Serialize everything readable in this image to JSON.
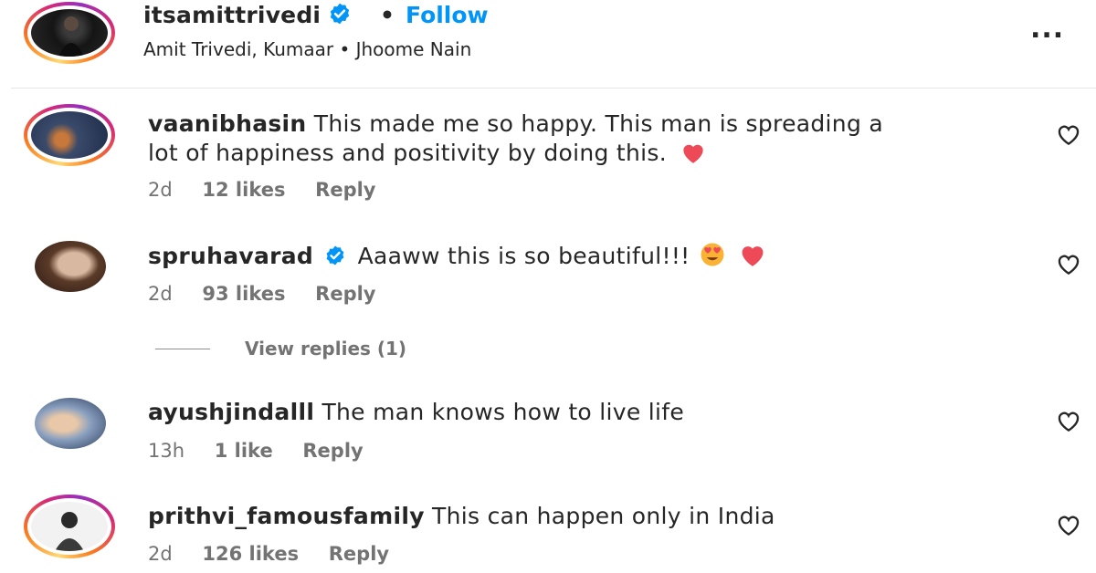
{
  "post": {
    "username": "itsamittrivedi",
    "separator": "•",
    "follow_label": "Follow",
    "audio": "Amit Trivedi, Kumaar • Jhoome Nain",
    "more_label": "..."
  },
  "comments": [
    {
      "username": "vaanibhasin",
      "text_line1": "This made me so happy. This man is spreading a",
      "text_line2": "lot of happiness and positivity by doing this.",
      "time": "2d",
      "likes": "12 likes",
      "reply": "Reply"
    },
    {
      "username": "spruhavarad",
      "text": "Aaaww this is so beautiful!!!",
      "time": "2d",
      "likes": "93 likes",
      "reply": "Reply",
      "view_replies": "View replies (1)"
    },
    {
      "username": "ayushjindalll",
      "text": "The man knows how to live life",
      "time": "13h",
      "likes": "1 like",
      "reply": "Reply"
    },
    {
      "username": "prithvi_famousfamily",
      "text": "This can happen only in India",
      "time": "2d",
      "likes": "126 likes",
      "reply": "Reply"
    }
  ],
  "colors": {
    "link": "#0095f6",
    "heart": "#ed4956",
    "verified": "#0095f6",
    "muted": "#737373"
  }
}
